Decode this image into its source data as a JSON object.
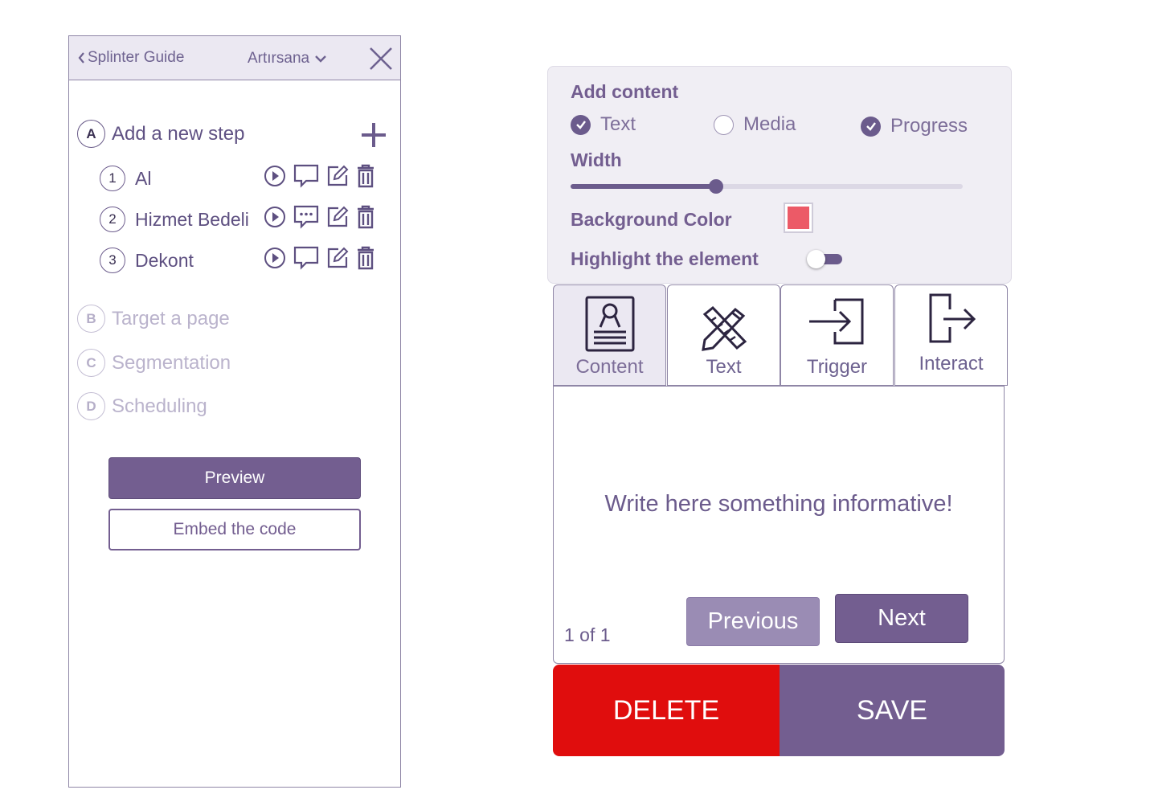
{
  "colors": {
    "primary": "#735e90",
    "header_bg": "#ebe8f2",
    "settings_bg": "#f0eef4",
    "delete": "#e00d0d",
    "background_color_value": "#ec5a67"
  },
  "left_panel": {
    "header": {
      "back_label": "Splinter Guide",
      "back_icon": "chevron-left-icon",
      "language_value": "Artırsana",
      "language_icon": "chevron-down-icon",
      "close_icon": "close-icon"
    },
    "sections": [
      {
        "letter": "A",
        "title": "Add a new step",
        "enabled": true
      },
      {
        "letter": "B",
        "title": "Target a page",
        "enabled": false
      },
      {
        "letter": "C",
        "title": "Segmentation",
        "enabled": false
      },
      {
        "letter": "D",
        "title": "Scheduling",
        "enabled": false
      }
    ],
    "add_icon": "plus-icon",
    "steps": [
      {
        "number": "1",
        "name": "Al"
      },
      {
        "number": "2",
        "name": "Hizmet Bedeli"
      },
      {
        "number": "3",
        "name": "Dekont"
      }
    ],
    "step_icons": [
      "play-icon",
      "comment-icon",
      "edit-icon",
      "trash-icon"
    ],
    "preview_label": "Preview",
    "embed_label": "Embed the code"
  },
  "settings": {
    "add_content_label": "Add  content",
    "options": [
      {
        "label": "Text",
        "checked": true
      },
      {
        "label": "Media",
        "checked": false
      },
      {
        "label": "Progress",
        "checked": true
      }
    ],
    "width_label": "Width",
    "width_value_percent": 37,
    "background_color_label": "Background Color",
    "highlight_label": "Highlight the element",
    "highlight_on": true
  },
  "tabs": [
    {
      "label": "Content",
      "icon": "content-icon",
      "active": true
    },
    {
      "label": "Text",
      "icon": "pencil-ruler-icon",
      "active": false
    },
    {
      "label": "Trigger",
      "icon": "sign-in-icon",
      "active": false
    },
    {
      "label": "Interact",
      "icon": "sign-out-icon",
      "active": false
    }
  ],
  "preview": {
    "message": "Write here something informative!",
    "page_counter": "1 of 1",
    "previous_label": "Previous",
    "next_label": "Next"
  },
  "actions": {
    "delete_label": "DELETE",
    "save_label": "SAVE"
  }
}
